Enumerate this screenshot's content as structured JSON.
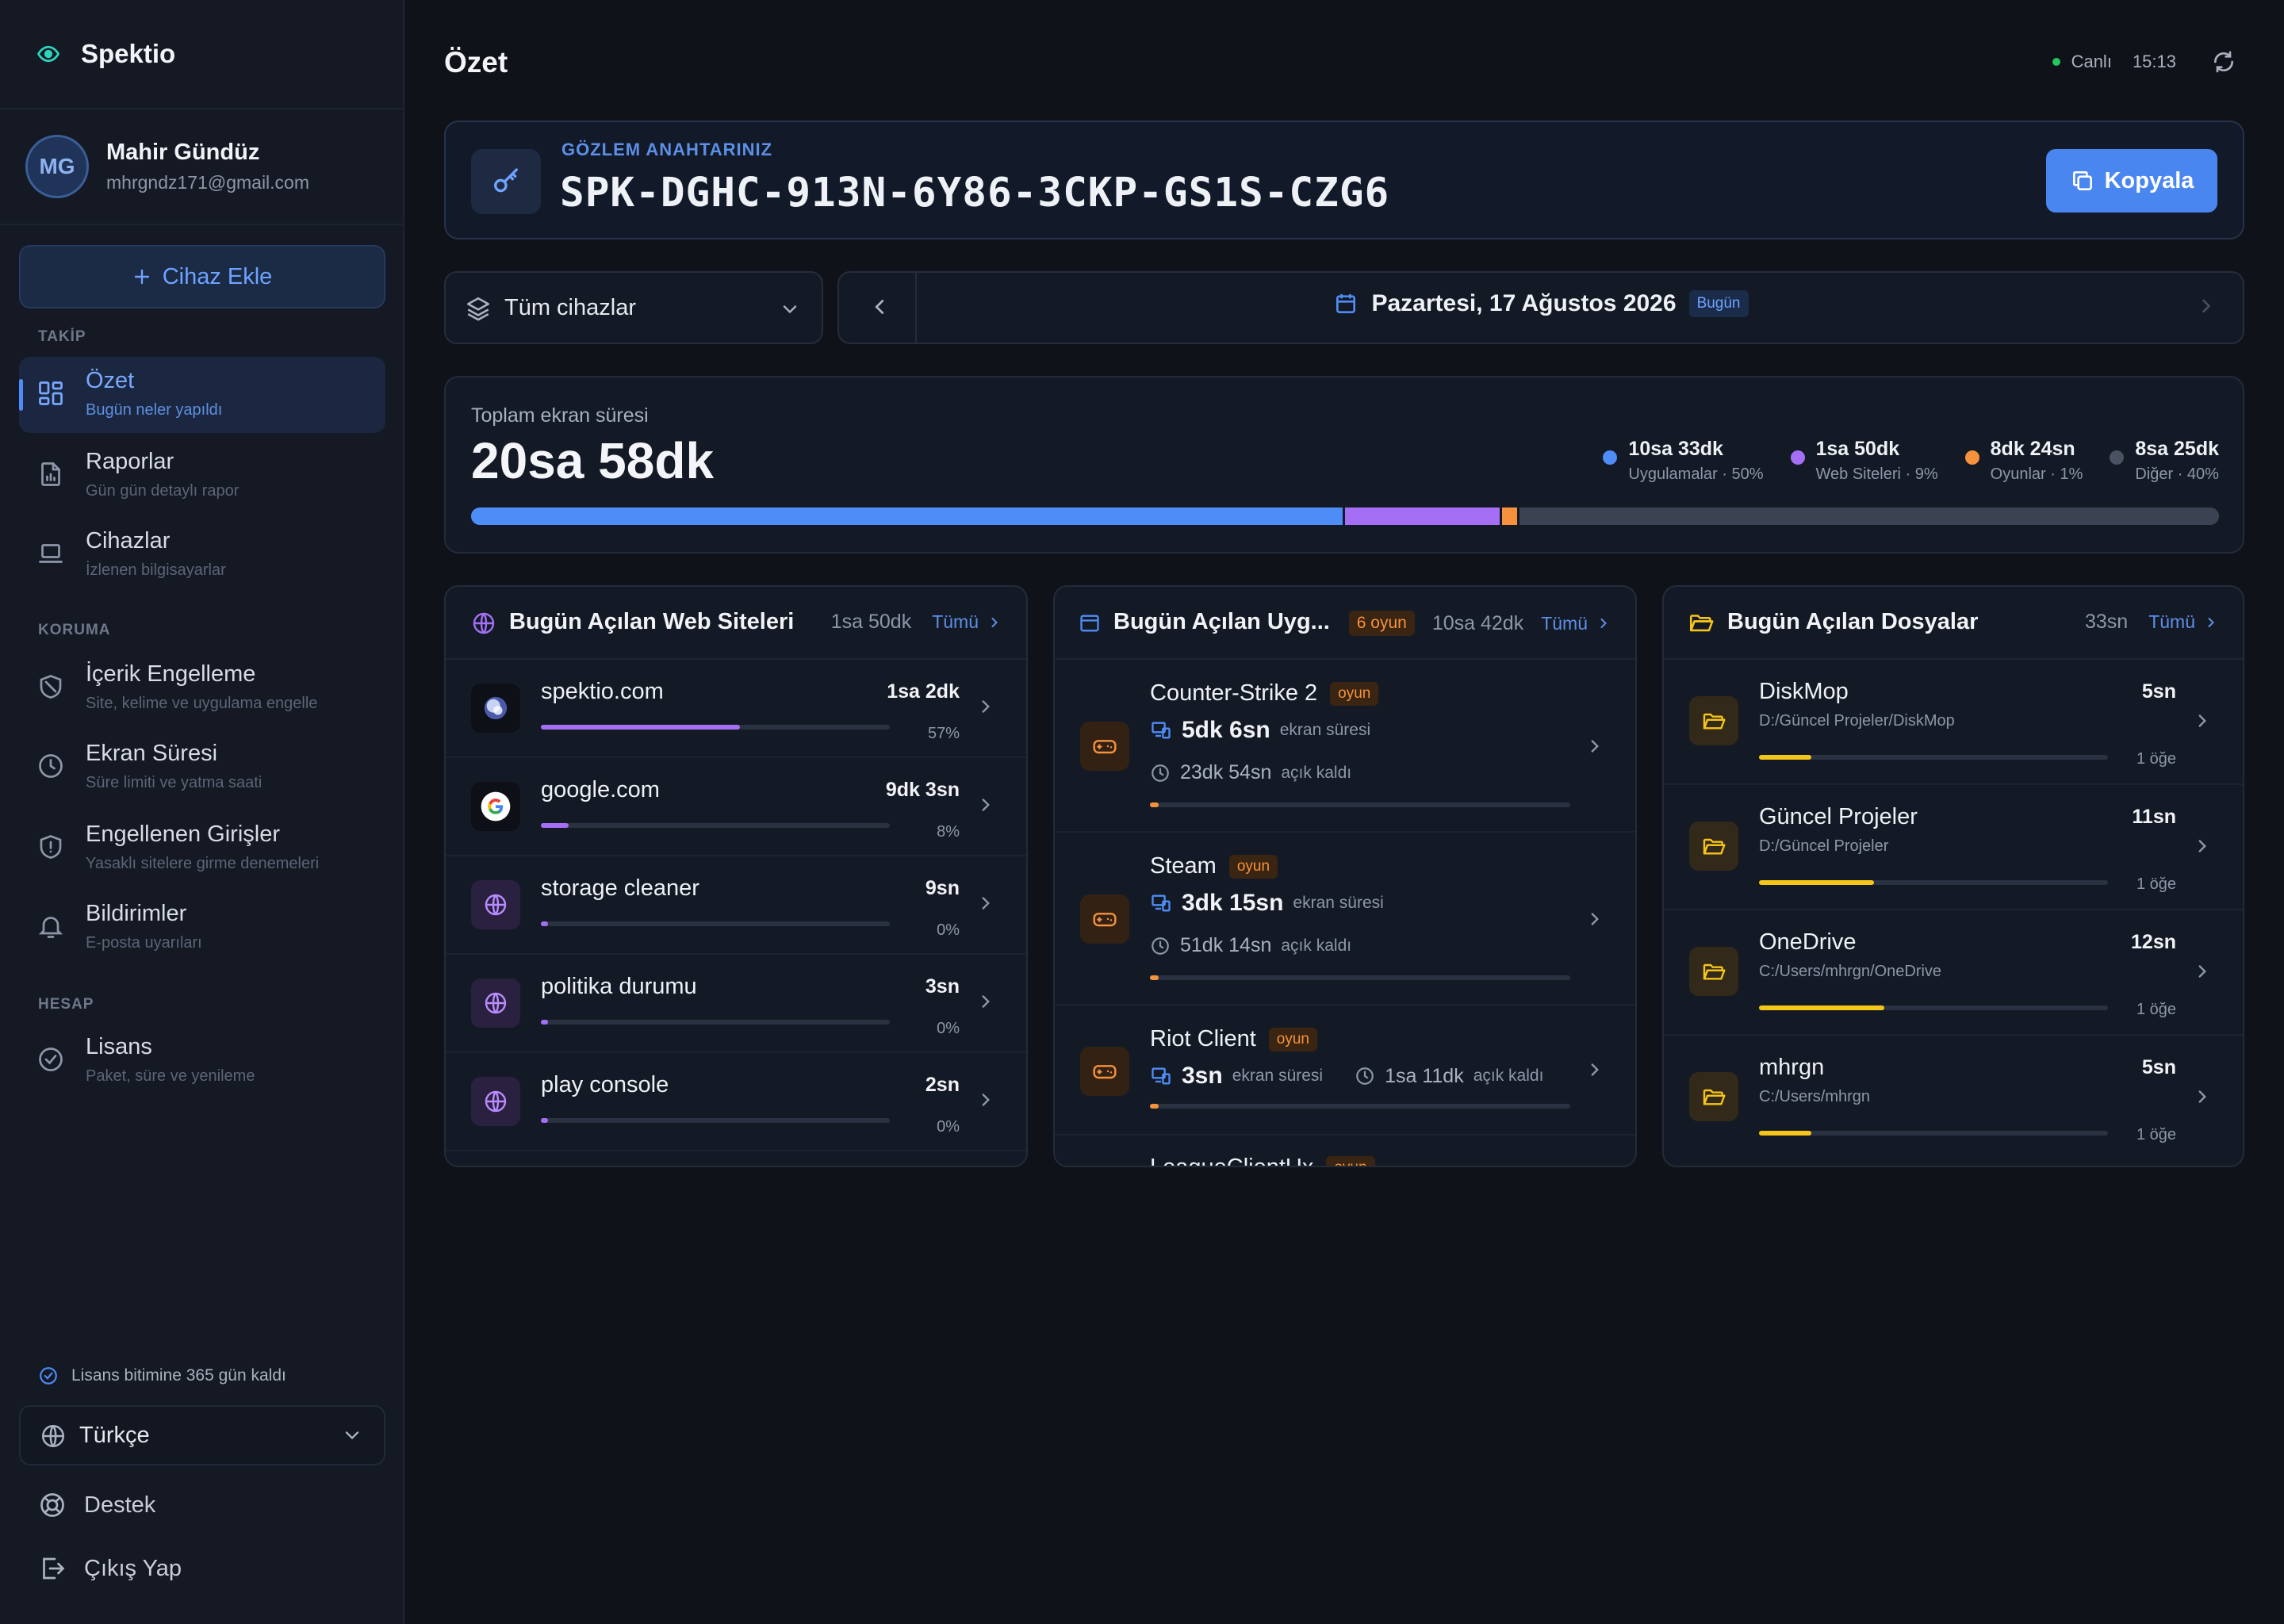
{
  "app": {
    "name": "Spektio"
  },
  "user": {
    "initials": "MG",
    "name": "Mahir Gündüz",
    "email": "mhrgndz171@gmail.com"
  },
  "sidebar": {
    "add_device": "Cihaz Ekle",
    "sections": {
      "takip": "TAKİP",
      "koruma": "KORUMA",
      "hesap": "HESAP"
    },
    "items": [
      {
        "title": "Özet",
        "sub": "Bugün neler yapıldı",
        "icon": "dashboard-icon"
      },
      {
        "title": "Raporlar",
        "sub": "Gün gün detaylı rapor",
        "icon": "report-icon"
      },
      {
        "title": "Cihazlar",
        "sub": "İzlenen bilgisayarlar",
        "icon": "laptop-icon"
      },
      {
        "title": "İçerik Engelleme",
        "sub": "Site, kelime ve uygulama engelle",
        "icon": "shield-block-icon"
      },
      {
        "title": "Ekran Süresi",
        "sub": "Süre limiti ve yatma saati",
        "icon": "clock-icon"
      },
      {
        "title": "Engellenen Girişler",
        "sub": "Yasaklı sitelere girme denemeleri",
        "icon": "shield-alert-icon"
      },
      {
        "title": "Bildirimler",
        "sub": "E-posta uyarıları",
        "icon": "bell-icon"
      },
      {
        "title": "Lisans",
        "sub": "Paket, süre ve yenileme",
        "icon": "badge-check-icon"
      }
    ],
    "license_note": "Lisans bitimine 365 gün kaldı",
    "language": "Türkçe",
    "support": "Destek",
    "logout": "Çıkış Yap"
  },
  "header": {
    "title": "Özet",
    "live_label": "Canlı",
    "time": "15:13"
  },
  "key_card": {
    "label": "GÖZLEM ANAHTARINIZ",
    "value": "SPK-DGHC-913N-6Y86-3CKP-GS1S-CZG6",
    "copy_label": "Kopyala"
  },
  "filter": {
    "device": "Tüm cihazlar",
    "date": "Pazartesi, 17 Ağustos 2026",
    "today_badge": "Bugün"
  },
  "total": {
    "label": "Toplam ekran süresi",
    "value": "20sa 58dk",
    "categories": [
      {
        "value": "10sa 33dk",
        "label": "Uygulamalar · 50%",
        "color": "#4e8cf7",
        "share": 50
      },
      {
        "value": "1sa 50dk",
        "label": "Web Siteleri · 9%",
        "color": "#a46ff5",
        "share": 9
      },
      {
        "value": "8dk 24sn",
        "label": "Oyunlar · 1%",
        "color": "#f5923b",
        "share": 1
      },
      {
        "value": "8sa 25dk",
        "label": "Diğer · 40%",
        "color": "#3b4252",
        "share": 40
      }
    ]
  },
  "web_panel": {
    "title": "Bugün Açılan Web Siteleri",
    "duration": "1sa 50dk",
    "all_label": "Tümü",
    "rows": [
      {
        "name": "spektio.com",
        "duration": "1sa 2dk",
        "percent": "57%",
        "share": 0.57,
        "icon": "spektio-logo-icon"
      },
      {
        "name": "google.com",
        "duration": "9dk 3sn",
        "percent": "8%",
        "share": 0.08,
        "icon": "google-logo-icon"
      },
      {
        "name": "storage cleaner",
        "duration": "9sn",
        "percent": "0%",
        "share": 0.01,
        "icon": "globe-icon"
      },
      {
        "name": "politika durumu",
        "duration": "3sn",
        "percent": "0%",
        "share": 0.01,
        "icon": "globe-icon"
      },
      {
        "name": "play console",
        "duration": "2sn",
        "percent": "0%",
        "share": 0.01,
        "icon": "globe-icon"
      }
    ]
  },
  "apps_panel": {
    "title": "Bugün Açılan Uyg...",
    "badge": "6 oyun",
    "duration": "10sa 42dk",
    "all_label": "Tümü",
    "screen_label": "ekran süresi",
    "open_label": "açık kaldı",
    "rows": [
      {
        "name": "Counter-Strike 2",
        "badge": "oyun",
        "screen": "5dk 6sn",
        "open": "23dk 54sn",
        "share": 0.01
      },
      {
        "name": "Steam",
        "badge": "oyun",
        "screen": "3dk 15sn",
        "open": "51dk 14sn",
        "share": 0.01
      },
      {
        "name": "Riot Client",
        "badge": "oyun",
        "screen": "3sn",
        "open": "1sa 11dk",
        "share": 0.01
      },
      {
        "name": "LeagueClientUx",
        "badge": "oyun"
      }
    ]
  },
  "files_panel": {
    "title": "Bugün Açılan Dosyalar",
    "duration": "33sn",
    "all_label": "Tümü",
    "rows": [
      {
        "name": "DiskMop",
        "path": "D:/Güncel Projeler/DiskMop",
        "duration": "5sn",
        "items": "1 öğe",
        "share": 0.15
      },
      {
        "name": "Güncel Projeler",
        "path": "D:/Güncel Projeler",
        "duration": "11sn",
        "items": "1 öğe",
        "share": 0.33
      },
      {
        "name": "OneDrive",
        "path": "C:/Users/mhrgn/OneDrive",
        "duration": "12sn",
        "items": "1 öğe",
        "share": 0.36
      },
      {
        "name": "mhrgn",
        "path": "C:/Users/mhrgn",
        "duration": "5sn",
        "items": "1 öğe",
        "share": 0.15
      }
    ]
  },
  "colors": {
    "accent": "#4e8cf7",
    "web": "#a46ff5",
    "game": "#f5923b",
    "file": "#f5c518"
  }
}
